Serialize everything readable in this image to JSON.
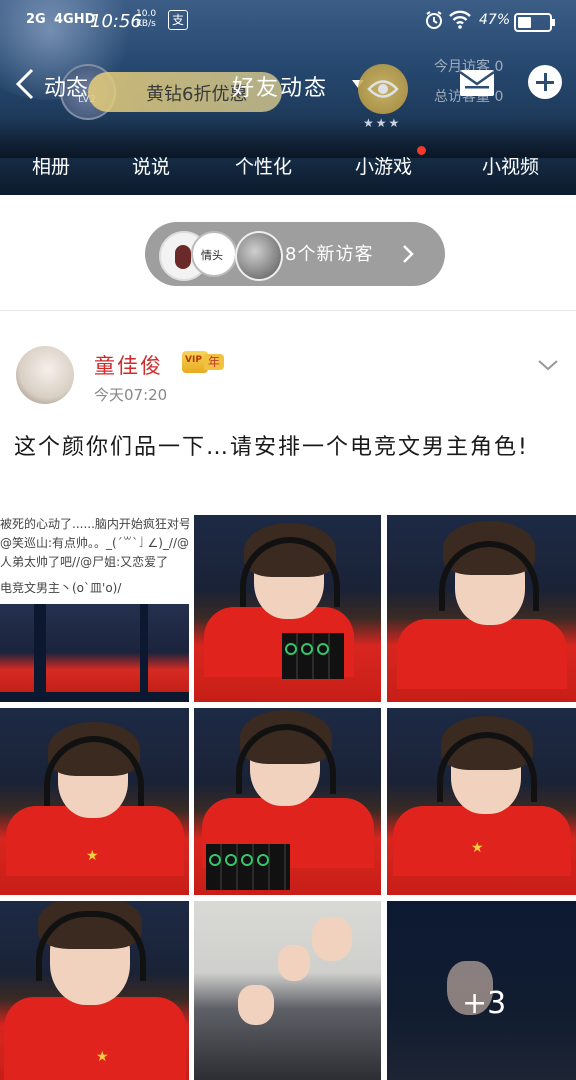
{
  "status_bar": {
    "signal_1": "2G",
    "signal_2": "4GHD",
    "time": "10:56",
    "speed_value": "10.0",
    "speed_unit": "KB/s",
    "app_badge": "支",
    "battery_percent": "47%"
  },
  "header": {
    "back_label": "动态",
    "avatar_level": "LV2",
    "promo_text": "黄钻6折优惠",
    "title": "好友动态",
    "visits_label_1": "今月访客 0",
    "visits_label_2": "总访客量 0",
    "stars": "★★★"
  },
  "nav_tabs": [
    "相册",
    "说说",
    "个性化",
    "小游戏",
    "小视频"
  ],
  "visitors": {
    "avatar_text": "情头",
    "text": "8个新访客"
  },
  "post": {
    "author": "童佳俊",
    "vip_badge": "年",
    "vip_crown": "VIP",
    "time": "今天07:20",
    "content": "这个颜你们品一下…请安排一个电竞文男主角色!",
    "screenshot_text": [
      "被死的心动了......脑内开始疯狂对号",
      "@笑巡山:有点帅。。_(ˊ꒳ˋ」∠)_//@",
      "人弟太帅了吧//@尸姐:又恋爱了",
      "电竞文男主丶(o`皿'o)/"
    ],
    "more_count": "+3"
  },
  "colors": {
    "accent_red": "#d02a2a",
    "header_blue": "#26486f",
    "pill_gray": "#9e9e9e",
    "notify_dot": "#f23b2b"
  }
}
